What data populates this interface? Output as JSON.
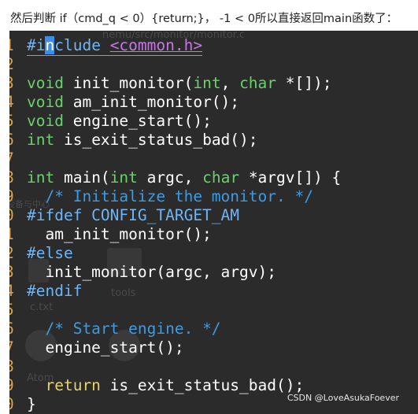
{
  "caption": "然后判断 if（cmd_q < 0）{return;}， -1 < 0所以直接返回main函数了：",
  "ghost": {
    "top_text": "nemu/src/monitor/monitor.c",
    "folder_label": "tools",
    "file_label": "c.txt",
    "left_label": "设备与中心",
    "bottom_label": "Atom"
  },
  "watermark": "CSDN @LoveAsukaFoever",
  "code_lines": [
    {
      "ln": "1",
      "tokens": [
        [
          "pp",
          "#i"
        ],
        [
          "cursor",
          "n"
        ],
        [
          "pp",
          "clude "
        ],
        [
          "str",
          "<common.h>"
        ]
      ],
      "cursor_line": true
    },
    {
      "ln": "2",
      "tokens": []
    },
    {
      "ln": "3",
      "tokens": [
        [
          "tp",
          "void"
        ],
        [
          "plain",
          " init_monitor("
        ],
        [
          "tp",
          "int"
        ],
        [
          "plain",
          ", "
        ],
        [
          "tp",
          "char"
        ],
        [
          "plain",
          " *[]);"
        ]
      ]
    },
    {
      "ln": "4",
      "tokens": [
        [
          "tp",
          "void"
        ],
        [
          "plain",
          " am_init_monitor();"
        ]
      ]
    },
    {
      "ln": "5",
      "tokens": [
        [
          "tp",
          "void"
        ],
        [
          "plain",
          " engine_start();"
        ]
      ]
    },
    {
      "ln": "6",
      "tokens": [
        [
          "tp",
          "int"
        ],
        [
          "plain",
          " is_exit_status_bad();"
        ]
      ]
    },
    {
      "ln": "7",
      "tokens": []
    },
    {
      "ln": "8",
      "tokens": [
        [
          "tp",
          "int"
        ],
        [
          "plain",
          " main("
        ],
        [
          "tp",
          "int"
        ],
        [
          "plain",
          " argc, "
        ],
        [
          "tp",
          "char"
        ],
        [
          "plain",
          " *argv[]) {"
        ]
      ]
    },
    {
      "ln": "9",
      "tokens": [
        [
          "plain",
          "  "
        ],
        [
          "cm",
          "/* Initialize the monitor. */"
        ]
      ]
    },
    {
      "ln": "0",
      "tokens": [
        [
          "pp",
          "#ifdef CONFIG_TARGET_AM"
        ]
      ]
    },
    {
      "ln": "1",
      "tokens": [
        [
          "plain",
          "  am_init_monitor();"
        ]
      ]
    },
    {
      "ln": "2",
      "tokens": [
        [
          "pp",
          "#else"
        ]
      ]
    },
    {
      "ln": "3",
      "tokens": [
        [
          "plain",
          "  init_monitor(argc, argv);"
        ]
      ]
    },
    {
      "ln": "4",
      "tokens": [
        [
          "pp",
          "#endif"
        ]
      ]
    },
    {
      "ln": "5",
      "tokens": []
    },
    {
      "ln": "6",
      "tokens": [
        [
          "plain",
          "  "
        ],
        [
          "cm",
          "/* Start engine. */"
        ]
      ]
    },
    {
      "ln": "7",
      "tokens": [
        [
          "plain",
          "  engine_start();"
        ]
      ]
    },
    {
      "ln": "8",
      "tokens": []
    },
    {
      "ln": "9",
      "tokens": [
        [
          "plain",
          "  "
        ],
        [
          "kw",
          "return"
        ],
        [
          "plain",
          " is_exit_status_bad();"
        ]
      ]
    },
    {
      "ln": "0",
      "tokens": [
        [
          "plain",
          "}"
        ]
      ]
    }
  ]
}
